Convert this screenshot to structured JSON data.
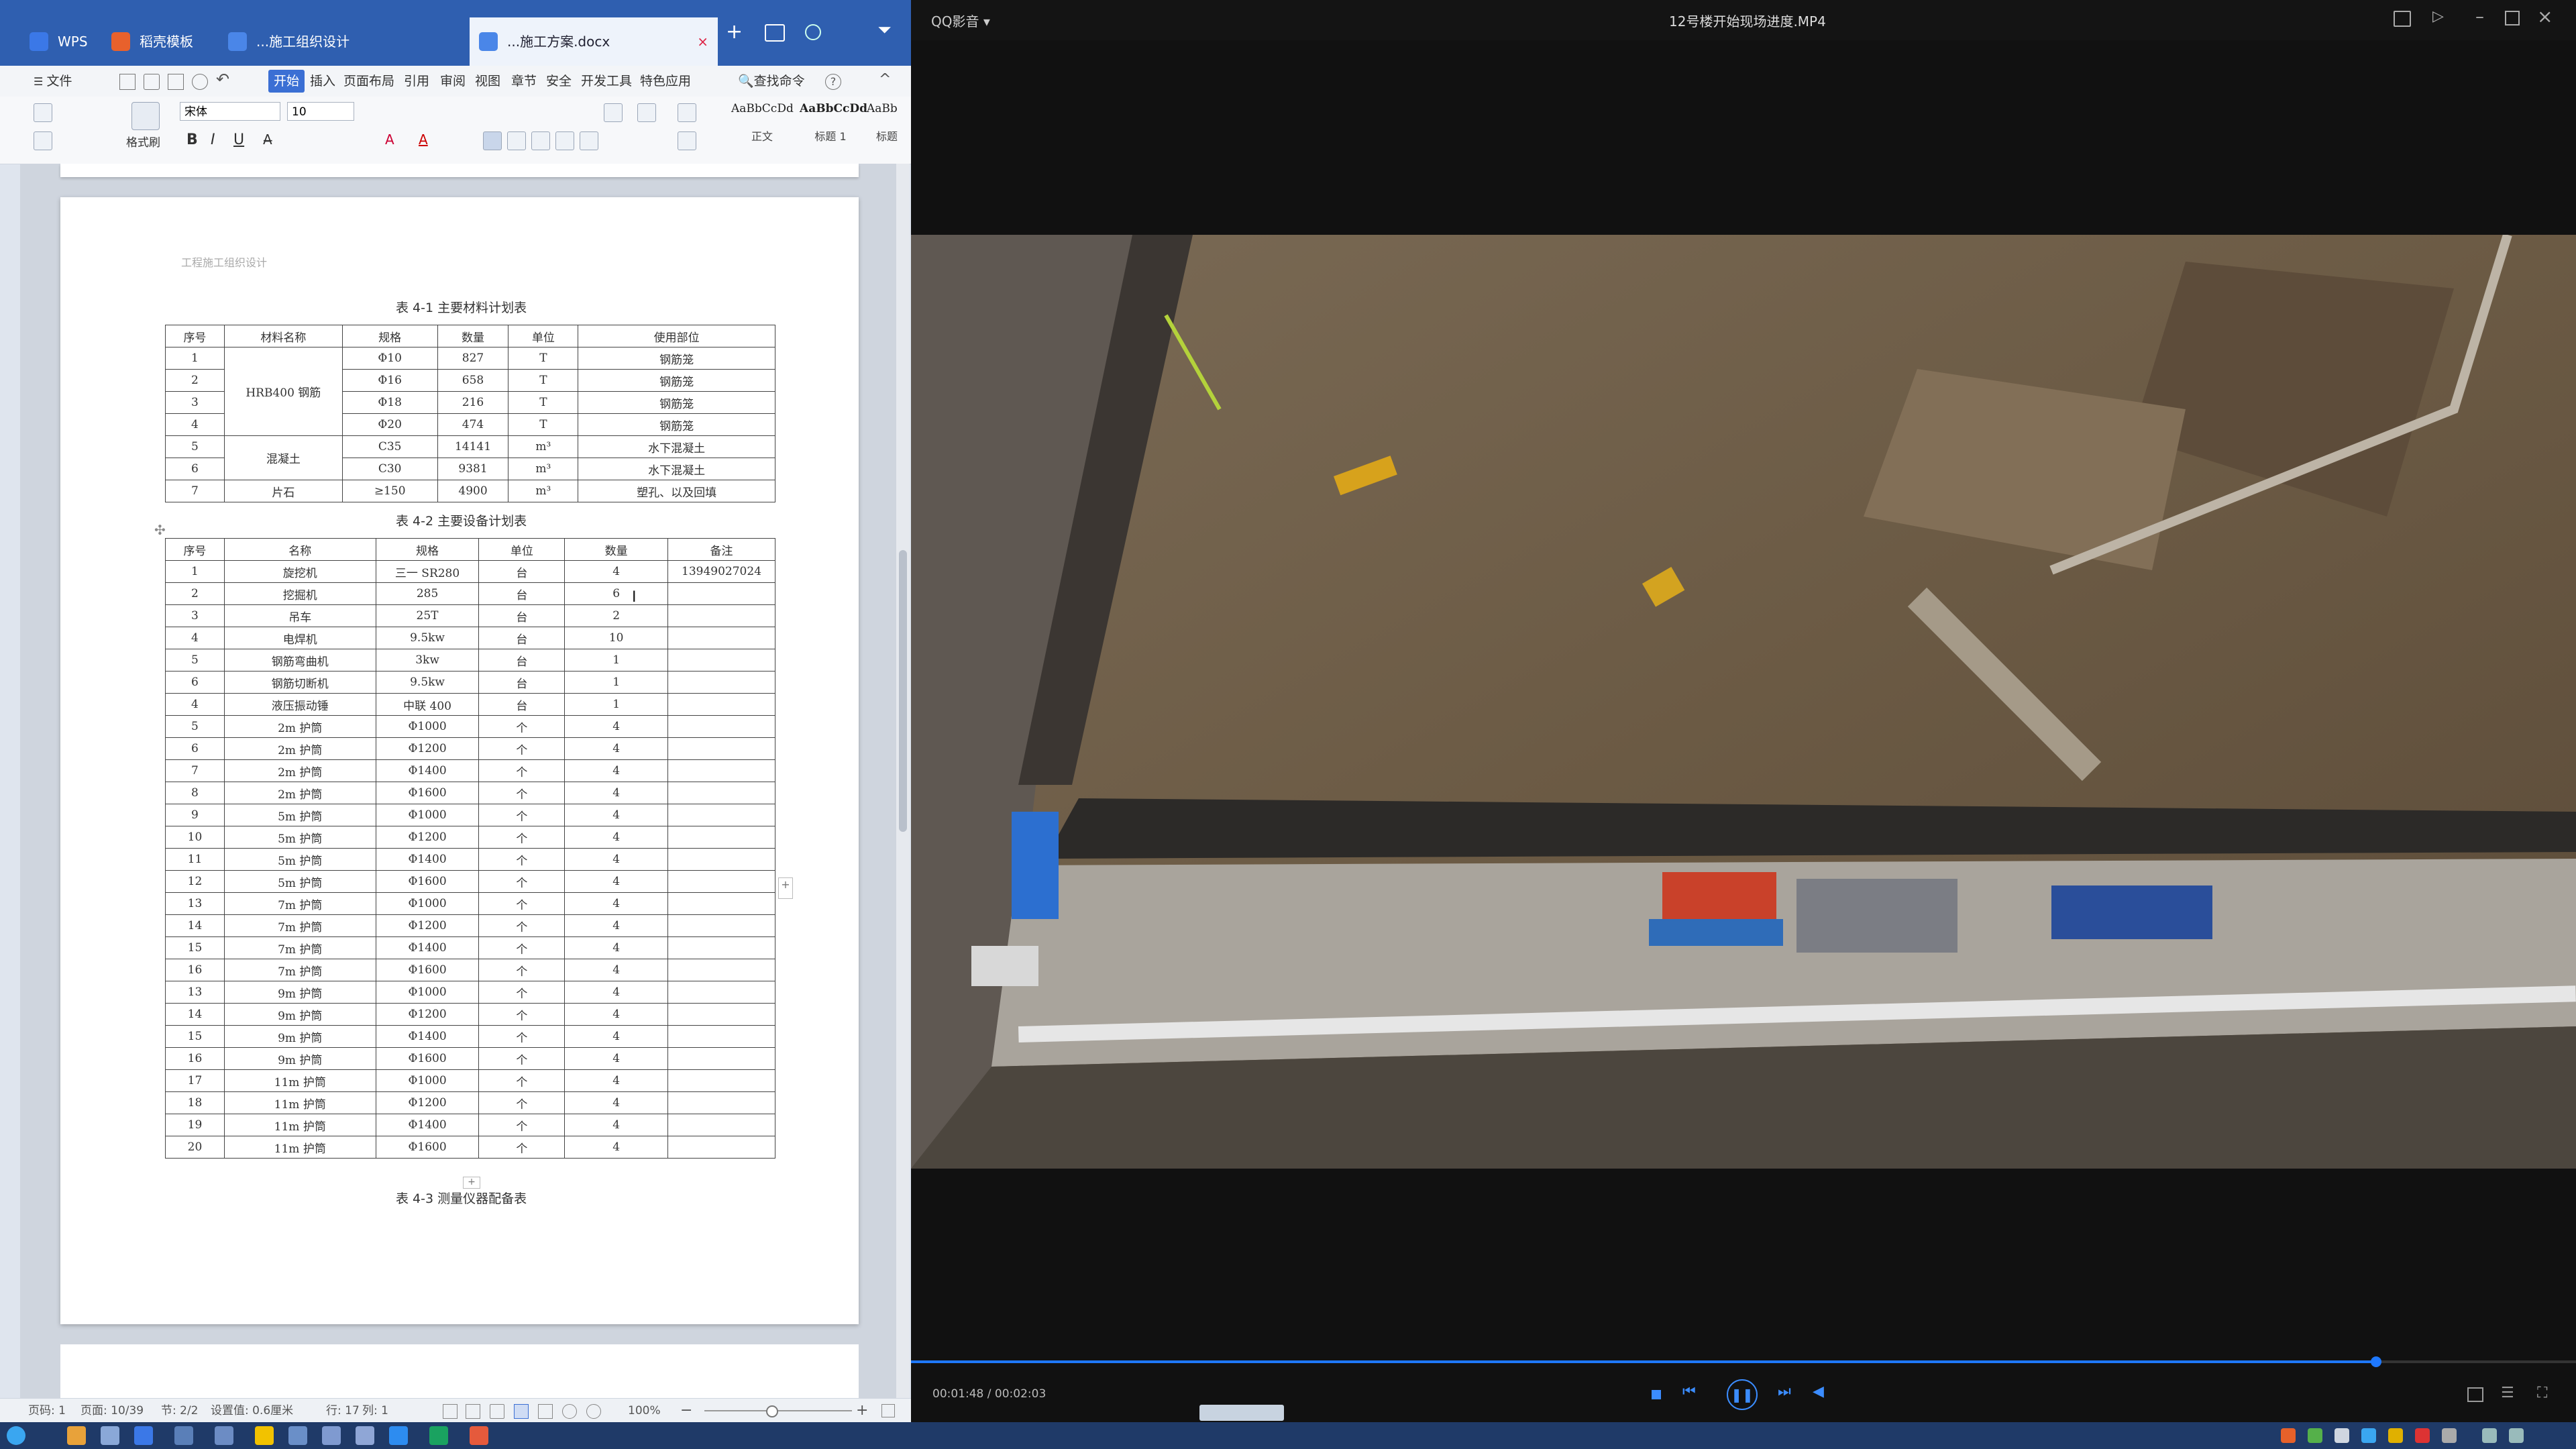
{
  "wps": {
    "tabs": [
      {
        "label": "WPS",
        "active": false
      },
      {
        "label": "稻壳模板",
        "active": false
      },
      {
        "label": "...施工组织设计",
        "active": false
      },
      {
        "label": "...施工方案.docx",
        "active": true
      }
    ],
    "menu": [
      "文件",
      "开始",
      "插入",
      "页面布局",
      "引用",
      "审阅",
      "视图",
      "章节",
      "安全",
      "开发工具",
      "特色应用",
      "查找命令"
    ],
    "menu_active": "开始",
    "font_name": "宋体",
    "font_size": "10",
    "styles": [
      {
        "preview": "AaBbCcDd",
        "label": "正文"
      },
      {
        "preview": "AaBbCcDd",
        "label": "标题 1"
      },
      {
        "preview": "AaBb",
        "label": "标题"
      }
    ],
    "header_text": "工程施工组织设计",
    "table1": {
      "caption": "表 4-1 主要材料计划表",
      "headers": [
        "序号",
        "材料名称",
        "规格",
        "数量",
        "单位",
        "使用部位"
      ],
      "material_group_1": "HRB400 钢筋",
      "material_group_2": "混凝土",
      "rows": [
        {
          "no": "1",
          "spec": "Φ10",
          "qty": "827",
          "unit": "T",
          "use": "钢筋笼"
        },
        {
          "no": "2",
          "spec": "Φ16",
          "qty": "658",
          "unit": "T",
          "use": "钢筋笼"
        },
        {
          "no": "3",
          "spec": "Φ18",
          "qty": "216",
          "unit": "T",
          "use": "钢筋笼"
        },
        {
          "no": "4",
          "spec": "Φ20",
          "qty": "474",
          "unit": "T",
          "use": "钢筋笼"
        },
        {
          "no": "5",
          "spec": "C35",
          "qty": "14141",
          "unit": "m³",
          "use": "水下混凝土"
        },
        {
          "no": "6",
          "spec": "C30",
          "qty": "9381",
          "unit": "m³",
          "use": "水下混凝土"
        },
        {
          "no": "7",
          "name": "片石",
          "spec": "≥150",
          "qty": "4900",
          "unit": "m³",
          "use": "塑孔、以及回填"
        }
      ]
    },
    "table2": {
      "caption": "表 4-2 主要设备计划表",
      "headers": [
        "序号",
        "名称",
        "规格",
        "单位",
        "数量",
        "备注"
      ],
      "rows": [
        {
          "no": "1",
          "name": "旋挖机",
          "spec": "三一 SR280",
          "unit": "台",
          "qty": "4",
          "note": "13949027024"
        },
        {
          "no": "2",
          "name": "挖掘机",
          "spec": "285",
          "unit": "台",
          "qty": "6",
          "note": ""
        },
        {
          "no": "3",
          "name": "吊车",
          "spec": "25T",
          "unit": "台",
          "qty": "2",
          "note": ""
        },
        {
          "no": "4",
          "name": "电焊机",
          "spec": "9.5kw",
          "unit": "台",
          "qty": "10",
          "note": ""
        },
        {
          "no": "5",
          "name": "钢筋弯曲机",
          "spec": "3kw",
          "unit": "台",
          "qty": "1",
          "note": ""
        },
        {
          "no": "6",
          "name": "钢筋切断机",
          "spec": "9.5kw",
          "unit": "台",
          "qty": "1",
          "note": ""
        },
        {
          "no": "4",
          "name": "液压振动锤",
          "spec": "中联 400",
          "unit": "台",
          "qty": "1",
          "note": ""
        },
        {
          "no": "5",
          "name": "2m 护筒",
          "spec": "Φ1000",
          "unit": "个",
          "qty": "4",
          "note": ""
        },
        {
          "no": "6",
          "name": "2m 护筒",
          "spec": "Φ1200",
          "unit": "个",
          "qty": "4",
          "note": ""
        },
        {
          "no": "7",
          "name": "2m 护筒",
          "spec": "Φ1400",
          "unit": "个",
          "qty": "4",
          "note": ""
        },
        {
          "no": "8",
          "name": "2m 护筒",
          "spec": "Φ1600",
          "unit": "个",
          "qty": "4",
          "note": ""
        },
        {
          "no": "9",
          "name": "5m 护筒",
          "spec": "Φ1000",
          "unit": "个",
          "qty": "4",
          "note": ""
        },
        {
          "no": "10",
          "name": "5m 护筒",
          "spec": "Φ1200",
          "unit": "个",
          "qty": "4",
          "note": ""
        },
        {
          "no": "11",
          "name": "5m 护筒",
          "spec": "Φ1400",
          "unit": "个",
          "qty": "4",
          "note": ""
        },
        {
          "no": "12",
          "name": "5m 护筒",
          "spec": "Φ1600",
          "unit": "个",
          "qty": "4",
          "note": ""
        },
        {
          "no": "13",
          "name": "7m 护筒",
          "spec": "Φ1000",
          "unit": "个",
          "qty": "4",
          "note": ""
        },
        {
          "no": "14",
          "name": "7m 护筒",
          "spec": "Φ1200",
          "unit": "个",
          "qty": "4",
          "note": ""
        },
        {
          "no": "15",
          "name": "7m 护筒",
          "spec": "Φ1400",
          "unit": "个",
          "qty": "4",
          "note": ""
        },
        {
          "no": "16",
          "name": "7m 护筒",
          "spec": "Φ1600",
          "unit": "个",
          "qty": "4",
          "note": ""
        },
        {
          "no": "13",
          "name": "9m 护筒",
          "spec": "Φ1000",
          "unit": "个",
          "qty": "4",
          "note": ""
        },
        {
          "no": "14",
          "name": "9m 护筒",
          "spec": "Φ1200",
          "unit": "个",
          "qty": "4",
          "note": ""
        },
        {
          "no": "15",
          "name": "9m 护筒",
          "spec": "Φ1400",
          "unit": "个",
          "qty": "4",
          "note": ""
        },
        {
          "no": "16",
          "name": "9m 护筒",
          "spec": "Φ1600",
          "unit": "个",
          "qty": "4",
          "note": ""
        },
        {
          "no": "17",
          "name": "11m 护筒",
          "spec": "Φ1000",
          "unit": "个",
          "qty": "4",
          "note": ""
        },
        {
          "no": "18",
          "name": "11m 护筒",
          "spec": "Φ1200",
          "unit": "个",
          "qty": "4",
          "note": ""
        },
        {
          "no": "19",
          "name": "11m 护筒",
          "spec": "Φ1400",
          "unit": "个",
          "qty": "4",
          "note": ""
        },
        {
          "no": "20",
          "name": "11m 护筒",
          "spec": "Φ1600",
          "unit": "个",
          "qty": "4",
          "note": ""
        }
      ]
    },
    "table3_caption": "表 4-3 测量仪器配备表",
    "status": {
      "page": "页码: 1",
      "pages": "页面: 10/39",
      "section": "节: 2/2",
      "setting": "设置值: 0.6厘米",
      "row": "行: 17",
      "col": "列: 1",
      "zoom": "100%"
    }
  },
  "player": {
    "app_name": "QQ影音",
    "file_title": "12号楼开始现场进度.MP4",
    "time_current": "00:01:48",
    "time_total": "00:02:03",
    "progress": 0.88
  },
  "colors": {
    "wps_blue": "#2f5fb0",
    "progress_blue": "#1e78ff",
    "taskbar": "#1f3a68"
  }
}
